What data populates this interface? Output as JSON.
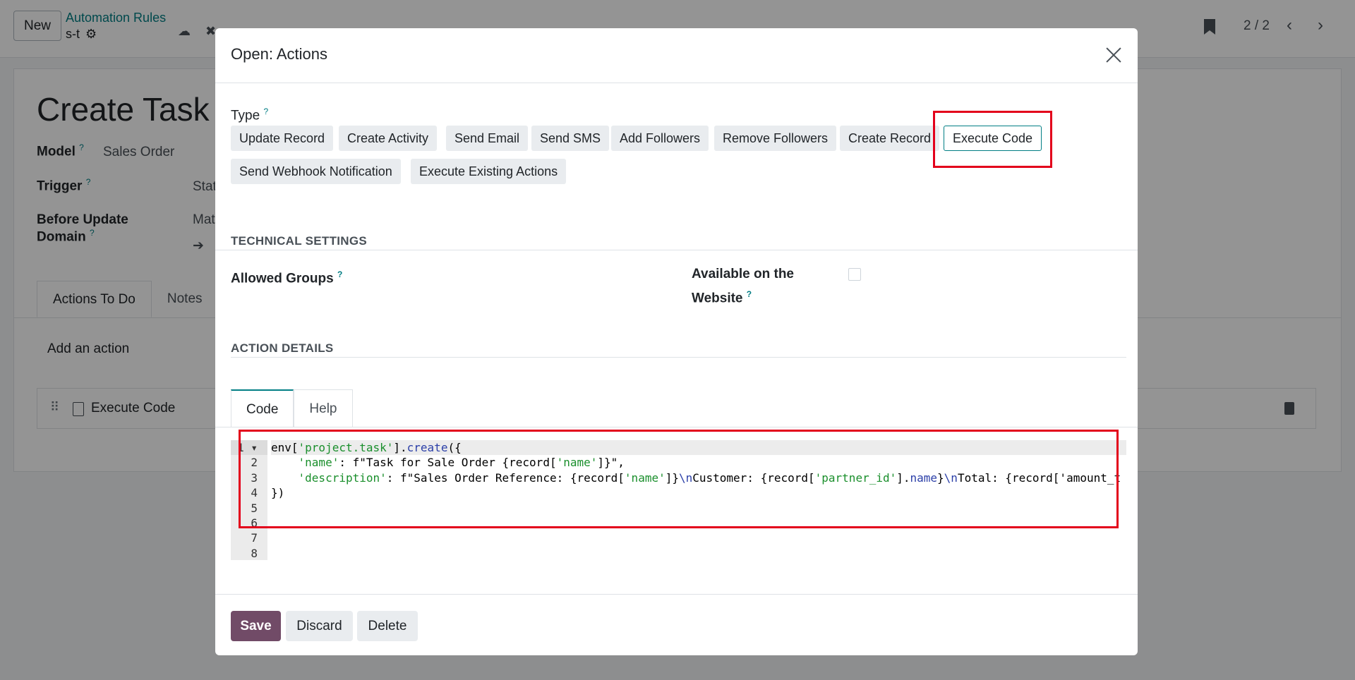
{
  "app": {
    "new_label": "New",
    "breadcrumb_parent": "Automation Rules",
    "breadcrumb_current": "s-t",
    "pager": "2 / 2"
  },
  "record": {
    "title": "Create Task c",
    "model_label": "Model",
    "model_value": "Sales Order",
    "trigger_label": "Trigger",
    "trigger_value": "Stat",
    "domain_label_1": "Before Update",
    "domain_label_2": "Domain",
    "domain_value": "Mat",
    "tabs": [
      "Actions To Do",
      "Notes"
    ],
    "add_action": "Add an action",
    "action_row": "Execute Code"
  },
  "modal": {
    "title": "Open: Actions",
    "type_label": "Type",
    "type_options": [
      "Update Record",
      "Create Activity",
      "Send Email",
      "Send SMS",
      "Add Followers",
      "Remove Followers",
      "Create Record",
      "Execute Code",
      "Send Webhook Notification",
      "Execute Existing Actions"
    ],
    "selected_type": "Execute Code",
    "technical_settings": "TECHNICAL SETTINGS",
    "allowed_groups": "Allowed Groups",
    "website_label_1": "Available on the",
    "website_label_2": "Website",
    "action_details": "ACTION DETAILS",
    "code_tabs": [
      "Code",
      "Help"
    ],
    "line_numbers": [
      "1",
      "2",
      "3",
      "4",
      "5",
      "6",
      "7",
      "8"
    ],
    "code": [
      "env['project.task'].create({",
      "    'name': f\"Task for Sale Order {record['name']}\",",
      "    'description': f\"Sales Order Reference: {record['name']}\\nCustomer: {record['partner_id'].name}\\nTotal: {record['amount_t",
      "})",
      "",
      "",
      "",
      ""
    ],
    "footer": {
      "save": "Save",
      "discard": "Discard",
      "delete": "Delete"
    }
  },
  "colors": {
    "primary": "#714b67",
    "accent": "#017e84",
    "highlight": "#e3001b"
  }
}
